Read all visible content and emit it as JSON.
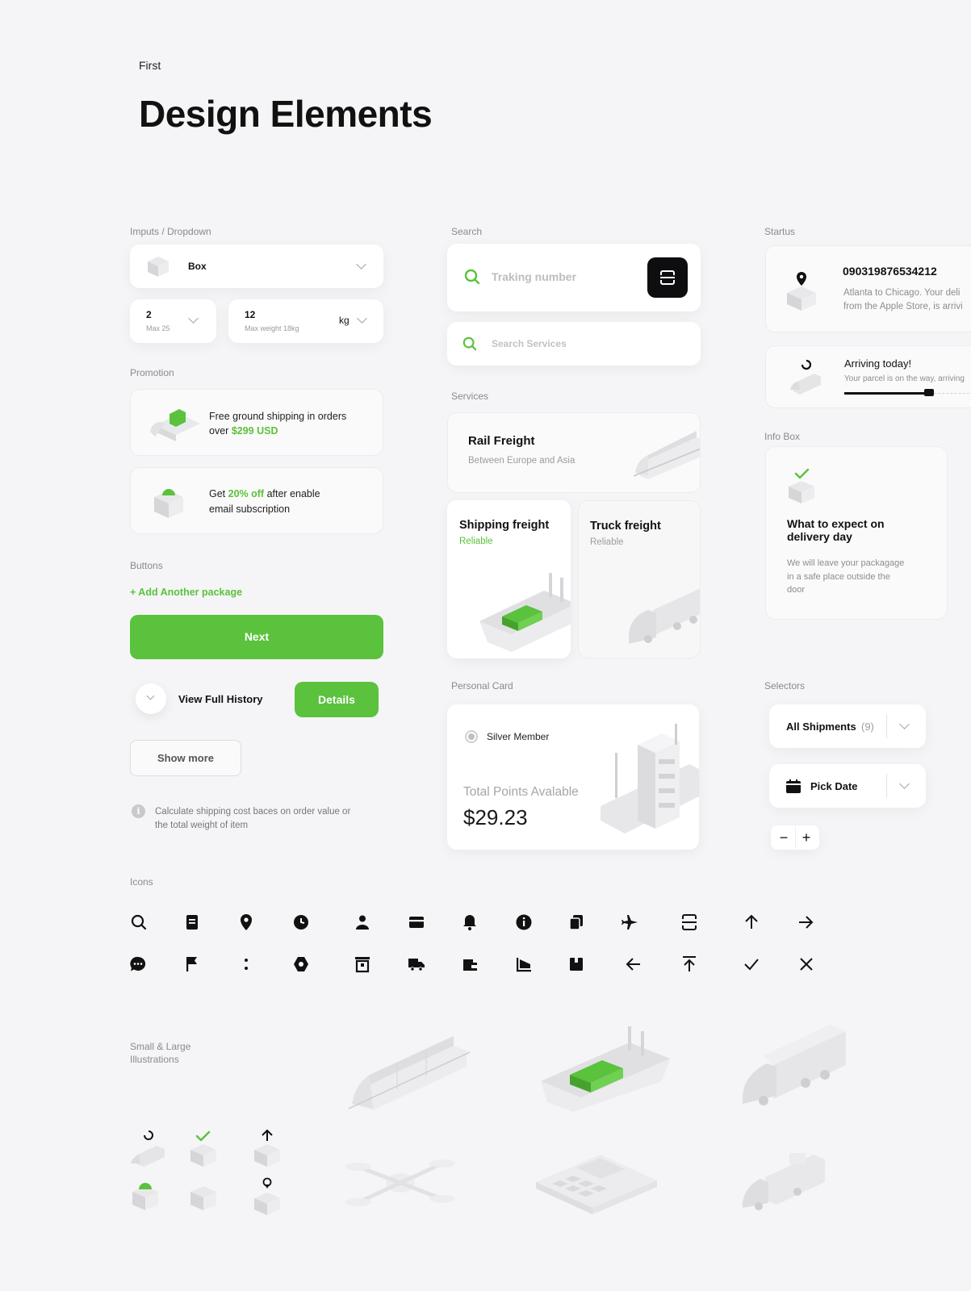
{
  "header": {
    "subtitle": "First",
    "title": "Design Elements"
  },
  "sections": {
    "inputs": "Imputs / Dropdown",
    "search": "Search",
    "status": "Startus",
    "promotion": "Promotion",
    "services": "Services",
    "info_box": "Info Box",
    "buttons": "Buttons",
    "personal_card": "Personal Card",
    "selectors": "Selectors",
    "icons": "Icons",
    "illustrations": "Small & Large Illustrations"
  },
  "inputs": {
    "dropdown_value": "Box",
    "qty_value": "2",
    "qty_hint": "Max 25",
    "weight_value": "12",
    "weight_hint": "Max weight 18kg",
    "weight_unit": "kg"
  },
  "search": {
    "tracking_placeholder": "Traking number",
    "services_placeholder": "Search Services"
  },
  "status": {
    "tracking_number": "090319876534212",
    "tracking_desc_1": "Atlanta to Chicago. Your deli",
    "tracking_desc_2": "from the Apple Store, is arrivi",
    "arriving_title": "Arriving today!",
    "arriving_desc": "Your parcel is on the way, arriving",
    "progress": 0.55
  },
  "promotion": {
    "promo1_text": "Free ground shipping in orders",
    "promo1_over": "over",
    "promo1_amount": "$299 USD",
    "promo2_get": "Get",
    "promo2_pct": "20% off",
    "promo2_rest": "after enable",
    "promo2_line2": "email subscription"
  },
  "services": {
    "rail_title": "Rail Freight",
    "rail_sub": "Between Europe and Asia",
    "ship_title": "Shipping freight",
    "ship_sub": "Reliable",
    "truck_title": "Truck freight",
    "truck_sub": "Reliable"
  },
  "info_box": {
    "title_1": "What to expect on",
    "title_2": "delivery day",
    "body_1": "We will leave your packagage",
    "body_2": "in a safe place outside the",
    "body_3": "door"
  },
  "buttons": {
    "add_package": "+ Add Another package",
    "next": "Next",
    "view_history": "View Full History",
    "details": "Details",
    "show_more": "Show more",
    "note_1": "Calculate shipping cost baces on order value or",
    "note_2": "the total weight of item"
  },
  "personal_card": {
    "member": "Silver Member",
    "points_label": "Total Points Avalable",
    "points_value": "$29.23"
  },
  "selectors": {
    "shipments_label": "All Shipments",
    "shipments_count": "(9)",
    "date_label": "Pick Date",
    "minus": "−",
    "plus": "+"
  },
  "icons_row1": [
    "search-icon",
    "document-icon",
    "location-pin-icon",
    "clock-icon",
    "user-icon",
    "card-icon",
    "bell-icon",
    "info-icon",
    "copy-icon",
    "plane-icon",
    "scan-icon",
    "arrow-up-icon",
    "arrow-right-icon"
  ],
  "icons_row2": [
    "chat-icon",
    "flag-icon",
    "more-vertical-icon",
    "settings-icon",
    "archive-icon",
    "truck-icon",
    "wallet-icon",
    "chart-icon",
    "box-icon",
    "arrow-left-icon",
    "upload-icon",
    "check-icon",
    "close-icon"
  ],
  "colors": {
    "accent": "#5ac23c",
    "background": "#f5f5f7",
    "text": "#111111"
  }
}
